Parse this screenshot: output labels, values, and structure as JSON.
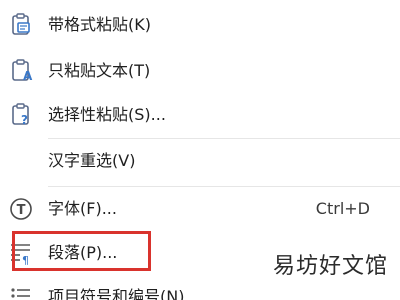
{
  "menu": {
    "items": [
      {
        "label": "带格式粘贴(K)",
        "icon": "paste-formatted-icon",
        "shortcut": ""
      },
      {
        "label": "只粘贴文本(T)",
        "icon": "paste-text-icon",
        "shortcut": ""
      },
      {
        "label": "选择性粘贴(S)...",
        "icon": "paste-special-icon",
        "shortcut": ""
      },
      {
        "label": "汉字重选(V)",
        "icon": "",
        "shortcut": ""
      },
      {
        "label": "字体(F)...",
        "icon": "font-icon",
        "shortcut": "Ctrl+D"
      },
      {
        "label": "段落(P)...",
        "icon": "paragraph-icon",
        "shortcut": ""
      },
      {
        "label": "项目符号和编号(N)...",
        "icon": "bullets-numbering-icon",
        "shortcut": ""
      }
    ]
  },
  "highlight": {
    "target": "段落(P)...",
    "color": "#d9332d"
  },
  "watermark": {
    "text": "易坊好文馆"
  }
}
